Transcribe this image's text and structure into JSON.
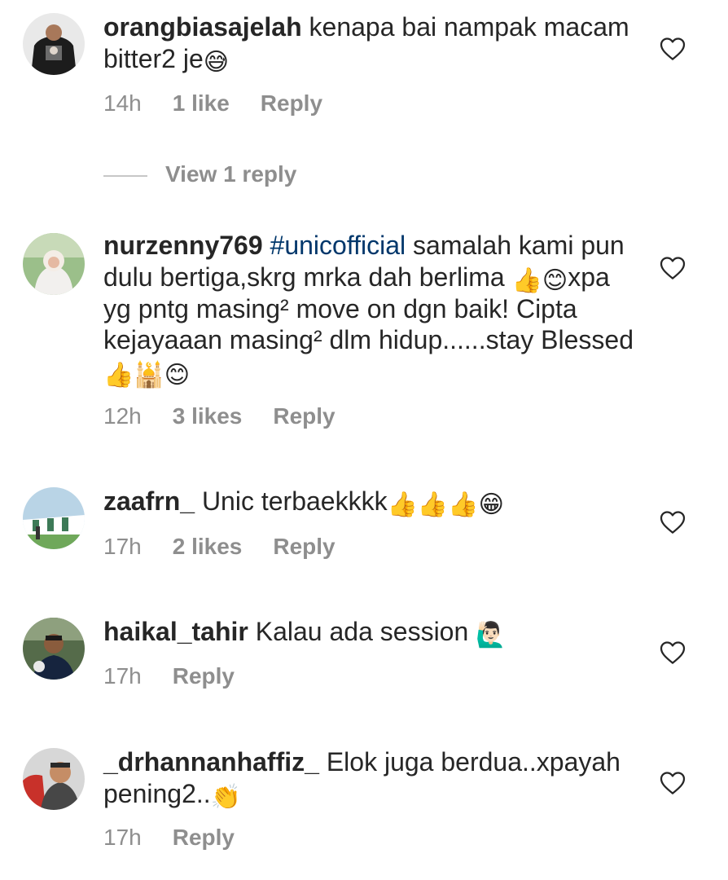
{
  "comments": [
    {
      "username": "orangbiasajelah",
      "text": "kenapa bai nampak macam bitter2 je",
      "emoji": "😅",
      "time": "14h",
      "likes": "1 like",
      "reply_label": "Reply",
      "view_replies": "View 1 reply"
    },
    {
      "username": "nurzenny769",
      "hashtag": "#unicofficial",
      "text_a": "samalah kami pun dulu bertiga,skrg mrka dah berlima",
      "emoji_a": "👍",
      "emoji_b": "😊",
      "text_b": "xpa yg pntg masing² move on dgn baik! Cipta kejayaaan masing² dlm hidup......stay Blessed",
      "emoji_c": "👍",
      "emoji_d": "🕌",
      "emoji_e": "😊",
      "time": "12h",
      "likes": "3 likes",
      "reply_label": "Reply"
    },
    {
      "username": "zaafrn_",
      "text": "Unic terbaekkkk",
      "emoji": "👍👍👍😁",
      "time": "17h",
      "likes": "2 likes",
      "reply_label": "Reply"
    },
    {
      "username": "haikal_tahir",
      "text": "Kalau ada session",
      "emoji": "🙋🏻‍♂️",
      "time": "17h",
      "reply_label": "Reply"
    },
    {
      "username": "_drhannanhaffiz_",
      "text": "Elok juga berdua..xpayah pening2..",
      "emoji": "👏",
      "time": "17h",
      "reply_label": "Reply"
    }
  ],
  "icons": {
    "like": "heart-outline-icon"
  },
  "colors": {
    "text": "#262626",
    "muted": "#8e8e8e",
    "hashtag": "#00376b"
  }
}
